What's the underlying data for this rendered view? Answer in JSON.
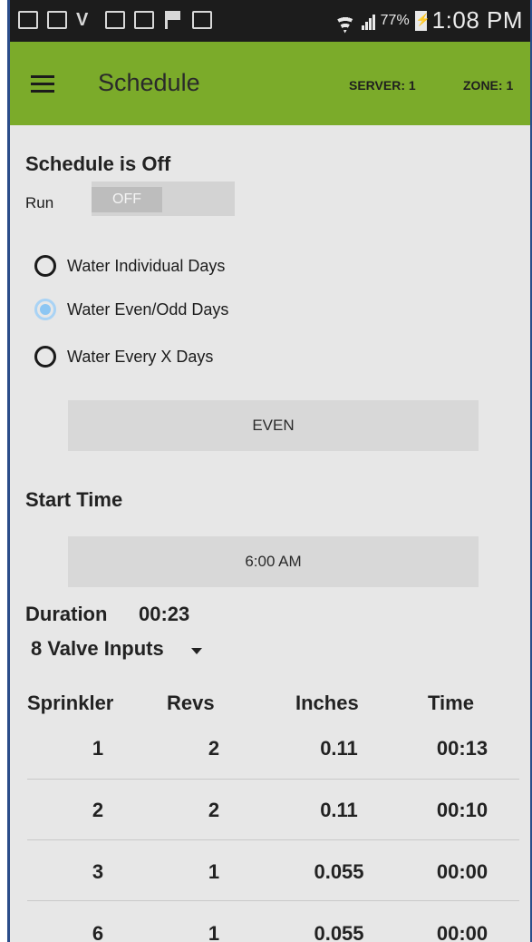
{
  "status_bar": {
    "battery_percent": "77%",
    "time": "1:08 PM",
    "icons": [
      "mail-icon",
      "image-icon",
      "vine-icon",
      "mail-settings-icon",
      "mail-settings-icon",
      "flag-icon",
      "bag-icon",
      "wifi-icon",
      "signal-icon",
      "battery-charging-icon"
    ]
  },
  "app_bar": {
    "title": "Schedule",
    "server": "SERVER: 1",
    "zone": "ZONE: 1",
    "color": "#7bab2a"
  },
  "schedule": {
    "status_heading": "Schedule is Off",
    "run_label": "Run",
    "toggle_state": "OFF",
    "options": [
      {
        "label": "Water Individual Days",
        "checked": false
      },
      {
        "label": "Water Even/Odd Days",
        "checked": true
      },
      {
        "label": "Water Every X Days",
        "checked": false
      }
    ],
    "even_odd_button": "EVEN",
    "start_time_heading": "Start Time",
    "start_time_button": "6:00 AM",
    "duration_label": "Duration",
    "duration_value": "00:23",
    "valve_inputs": "8 Valve Inputs"
  },
  "table": {
    "headers": [
      "Sprinkler",
      "Revs",
      "Inches",
      "Time"
    ],
    "rows": [
      [
        "1",
        "2",
        "0.11",
        "00:13"
      ],
      [
        "2",
        "2",
        "0.11",
        "00:10"
      ],
      [
        "3",
        "1",
        "0.055",
        "00:00"
      ],
      [
        "6",
        "1",
        "0.055",
        "00:00"
      ]
    ]
  }
}
